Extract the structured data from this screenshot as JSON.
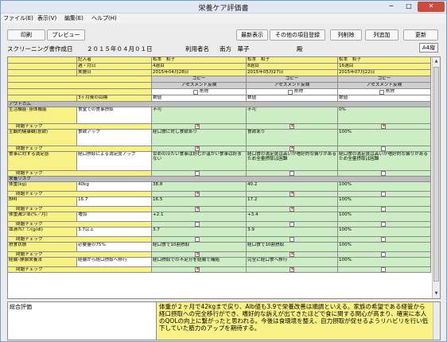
{
  "window": {
    "title": "栄養ケア評価書",
    "min": "─",
    "max": "□",
    "close": "✕"
  },
  "menu": {
    "file": "ファイル(E)",
    "view": "表示(V)",
    "edit": "編集(E)",
    "help": "ヘルプ(H)"
  },
  "toolbar": {
    "print": "印刷",
    "preview": "プレビュー",
    "latest": "最新表示",
    "register_other": "その他の項目登録",
    "delete_col": "列削除",
    "add_col": "列追加",
    "update": "更新"
  },
  "info": {
    "screening_label": "スクリーニング書作成日",
    "screening_date": "２０１５年０４月０１日",
    "user_label": "利用者名",
    "user_name": "南方　華子",
    "honorific": "殿",
    "paper": "A4縦"
  },
  "header": {
    "row_labels": [
      "記入者",
      "週・月日",
      "実施日"
    ],
    "copy": "コピー",
    "assess": "アセスメント反映",
    "delete": "削除",
    "goal_label": "3ヶ月後の目標",
    "goal_value": "数値",
    "outcome": "アウトカム",
    "risk": "栄養リスク",
    "check": "問題チェック",
    "columns": [
      {
        "writer": "松本　和子",
        "week": "4週目",
        "date": "2015年04月28日"
      },
      {
        "writer": "松本　和子",
        "week": "8週目",
        "date": "2015年05月27日"
      },
      {
        "writer": "松本　和子",
        "week": "16週目",
        "date": "2015年07月22日"
      }
    ]
  },
  "rows": [
    {
      "label": "生活機能･身体機能",
      "goal": "食堂での食事摂取",
      "v": [
        "不可",
        "不可",
        "0%"
      ],
      "chk": [
        true,
        true,
        true
      ]
    },
    {
      "label": "主観的健康観(意欲)",
      "goal": "食欲アップ",
      "v": [
        "経口食に対し食欲あり",
        "食欲あり",
        "100%"
      ],
      "chk": [
        true,
        true,
        false
      ]
    },
    {
      "label": "食事に対する満足感",
      "goal": "経口摂取による満足度アップ",
      "v": [
        "甘めの冷たい食事は好むが温かい食事は好まない",
        "経口食の満足度は高いが嗜好的な偏りがあるため全量摂取は困難",
        "経口食の満足度は高いが嗜好的な偏りがあるため全量摂取は困難"
      ],
      "chk": [
        false,
        false,
        false
      ]
    },
    {
      "label": "体重(kg)",
      "goal": "40kg",
      "v": [
        "38.8",
        "40.2",
        "100%"
      ],
      "chk": [
        true,
        true,
        false
      ]
    },
    {
      "label": "BMI",
      "goal": "16.7",
      "v": [
        "16.5",
        "17.2",
        "100%"
      ],
      "chk": [
        true,
        true,
        false
      ]
    },
    {
      "label": "体重減少率(%／月)",
      "goal": "増加",
      "v": [
        "+2.1",
        "+3.4",
        "100%"
      ],
      "chk": [
        false,
        false,
        false
      ]
    },
    {
      "label": "血清ｱﾙﾌﾞﾐﾝ(g/dl)",
      "goal": "3.7以上",
      "v": [
        "3.7",
        "3.9",
        "100%"
      ],
      "chk": [
        false,
        false,
        false
      ]
    },
    {
      "label": "摂食状態",
      "goal": "必要量の75%",
      "v": [
        "経口食で10割摂取",
        "経口食で10割摂取",
        "100%"
      ],
      "chk": [
        true,
        true,
        false
      ]
    },
    {
      "label": "経腸･静脈栄養法",
      "goal": "経腸から経口摂取へ移行",
      "v": [
        "経口摂取での不足分を経腸で補給",
        "完全に経口食へ移行",
        "100%"
      ],
      "chk": [
        true,
        true,
        false
      ]
    }
  ],
  "summary": {
    "label": "総合評価",
    "text": "体重が２ヶ月で42kgまで戻り、Alb値も3.9で栄養改善は順調といえる。家族の希望である経管から経口摂取への完全移行ができ、嗜好的な訴えが出てきたほどで食に関する関心が高まり、確実に本人のQOLの向上に繋がったと思われる。今後は食環境を整え、自力摂取が促せるようリハビリを行い低下していた筋力のアップを期待する。"
  }
}
